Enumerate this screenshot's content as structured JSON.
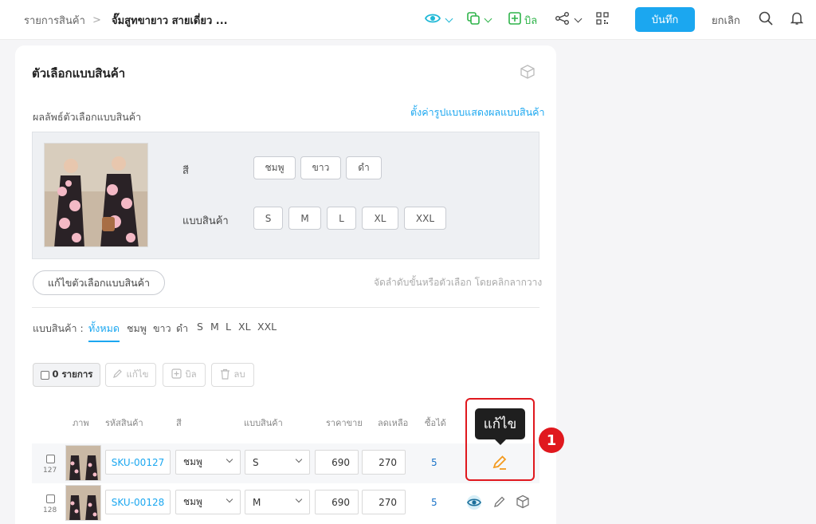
{
  "topbar": {
    "breadcrumb_root": "รายการสินค้า",
    "breadcrumb_sep": ">",
    "breadcrumb_current": "จั๊มสูทขายาว สายเดี่ยว ...",
    "bill_label": "บิล",
    "save_label": "บันทึก",
    "cancel_label": "ยกเลิก",
    "accent_color": "#1ba7f0",
    "icon_color": "#1fb8d6"
  },
  "card": {
    "title": "ตัวเลือกแบบสินค้า",
    "result_label": "ผลลัพธ์ตัวเลือกแบบสินค้า",
    "display_link": "ตั้งค่ารูปแบบแสดงผลแบบสินค้า",
    "color_label": "สี",
    "colors": [
      "ชมพู",
      "ขาว",
      "ดำ"
    ],
    "variant_label": "แบบสินค้า",
    "sizes": [
      "S",
      "M",
      "L",
      "XL",
      "XXL"
    ],
    "edit_options_button": "แก้ไขตัวเลือกแบบสินค้า",
    "drag_hint": "จัดลำดับขั้นหรือตัวเลือก โดยคลิกลากวาง"
  },
  "filter": {
    "label": "แบบสินค้า :",
    "tabs": [
      "ทั้งหมด",
      "ชมพู",
      "ขาว",
      "ดำ",
      "S",
      "M",
      "L",
      "XL",
      "XXL"
    ],
    "active": "ทั้งหมด"
  },
  "toolbar": {
    "selected_count": "0 รายการ",
    "edit_label": "แก้ไข",
    "bill_label": "บิล",
    "delete_label": "ลบ"
  },
  "table": {
    "headers": {
      "image": "ภาพ",
      "sku": "รหัสสินค้า",
      "color": "สี",
      "variant": "แบบสินค้า",
      "price": "ราคาขาย",
      "discount": "ลดเหลือ",
      "qty": "ซื้อได้"
    },
    "rows": [
      {
        "num": "127",
        "sku": "SKU-00127",
        "color": "ชมพู",
        "size": "S",
        "price": "690",
        "discount": "270",
        "qty": "5"
      },
      {
        "num": "128",
        "sku": "SKU-00128",
        "color": "ชมพู",
        "size": "M",
        "price": "690",
        "discount": "270",
        "qty": "5"
      }
    ]
  },
  "annotation": {
    "tooltip": "แก้ไข",
    "badge": "1",
    "highlight_color": "#e0181e"
  }
}
